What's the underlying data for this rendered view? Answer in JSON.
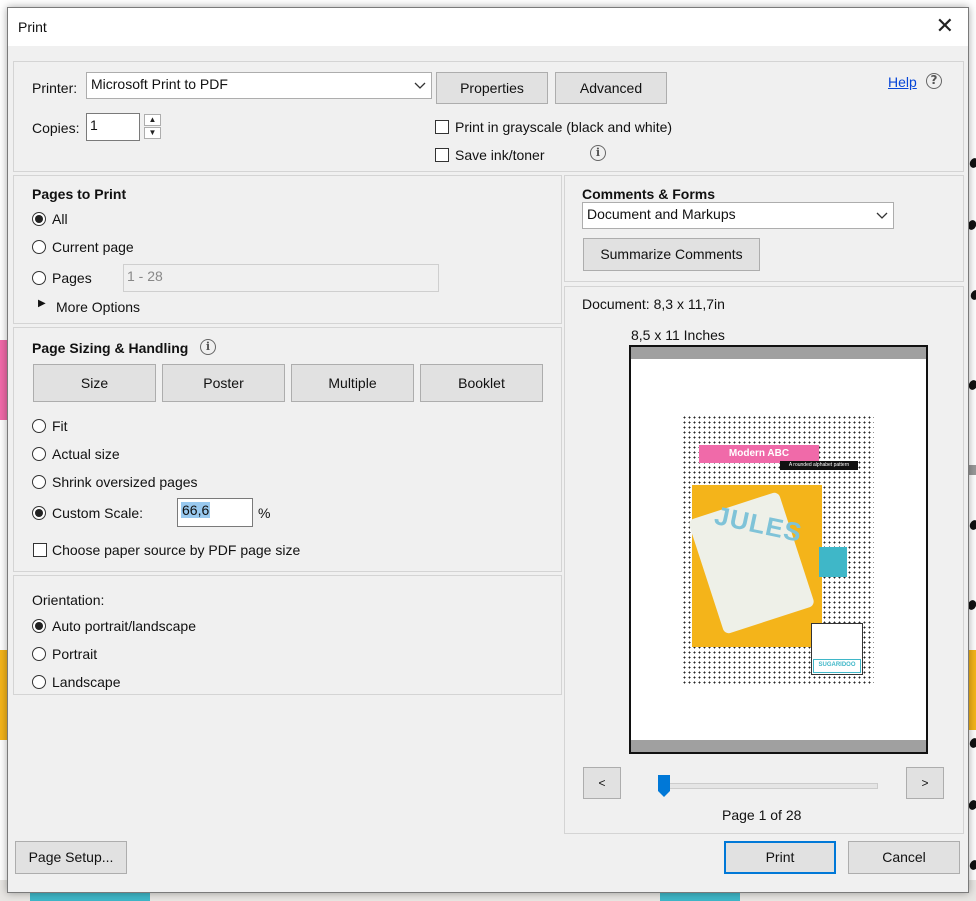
{
  "window": {
    "title": "Print",
    "close_glyph": "✕"
  },
  "printer": {
    "label": "Printer:",
    "selected": "Microsoft Print to PDF",
    "properties_label": "Properties",
    "advanced_label": "Advanced",
    "copies_label": "Copies:",
    "copies_value": "1",
    "grayscale_label": "Print in grayscale (black and white)",
    "grayscale_checked": false,
    "save_ink_label": "Save ink/toner",
    "save_ink_checked": false,
    "help_label": "Help"
  },
  "pages_to_print": {
    "heading": "Pages to Print",
    "options": [
      {
        "label": "All",
        "selected": true
      },
      {
        "label": "Current page",
        "selected": false
      },
      {
        "label": "Pages",
        "selected": false
      }
    ],
    "pages_value": "1 - 28",
    "more_options": "More Options"
  },
  "sizing": {
    "heading": "Page Sizing & Handling",
    "tabs": [
      "Size",
      "Poster",
      "Multiple",
      "Booklet"
    ],
    "options": [
      {
        "label": "Fit",
        "selected": false
      },
      {
        "label": "Actual size",
        "selected": false
      },
      {
        "label": "Shrink oversized pages",
        "selected": false
      },
      {
        "label": "Custom Scale:",
        "selected": true
      }
    ],
    "custom_scale_value": "66,6",
    "percent": "%",
    "paper_source_label": "Choose paper source by PDF page size",
    "paper_source_checked": false
  },
  "orientation": {
    "heading": "Orientation:",
    "options": [
      {
        "label": "Auto portrait/landscape",
        "selected": true
      },
      {
        "label": "Portrait",
        "selected": false
      },
      {
        "label": "Landscape",
        "selected": false
      }
    ]
  },
  "comments_forms": {
    "heading": "Comments & Forms",
    "selected": "Document and Markups",
    "summarize_label": "Summarize Comments"
  },
  "preview": {
    "document_size": "Document: 8,3 x 11,7in",
    "paper_size": "8,5 x 11 Inches",
    "poster_title": "Modern ABC",
    "poster_subtitle": "A rounded alphabet pattern",
    "poster_name": "JULES",
    "poster_logo": "SUGARIDOO",
    "prev_label": "<",
    "next_label": ">",
    "current_page": 1,
    "total_pages": 28,
    "page_status": "Page 1 of 28",
    "accent_color": "#0078d7"
  },
  "footer": {
    "page_setup_label": "Page Setup...",
    "print_label": "Print",
    "cancel_label": "Cancel"
  }
}
